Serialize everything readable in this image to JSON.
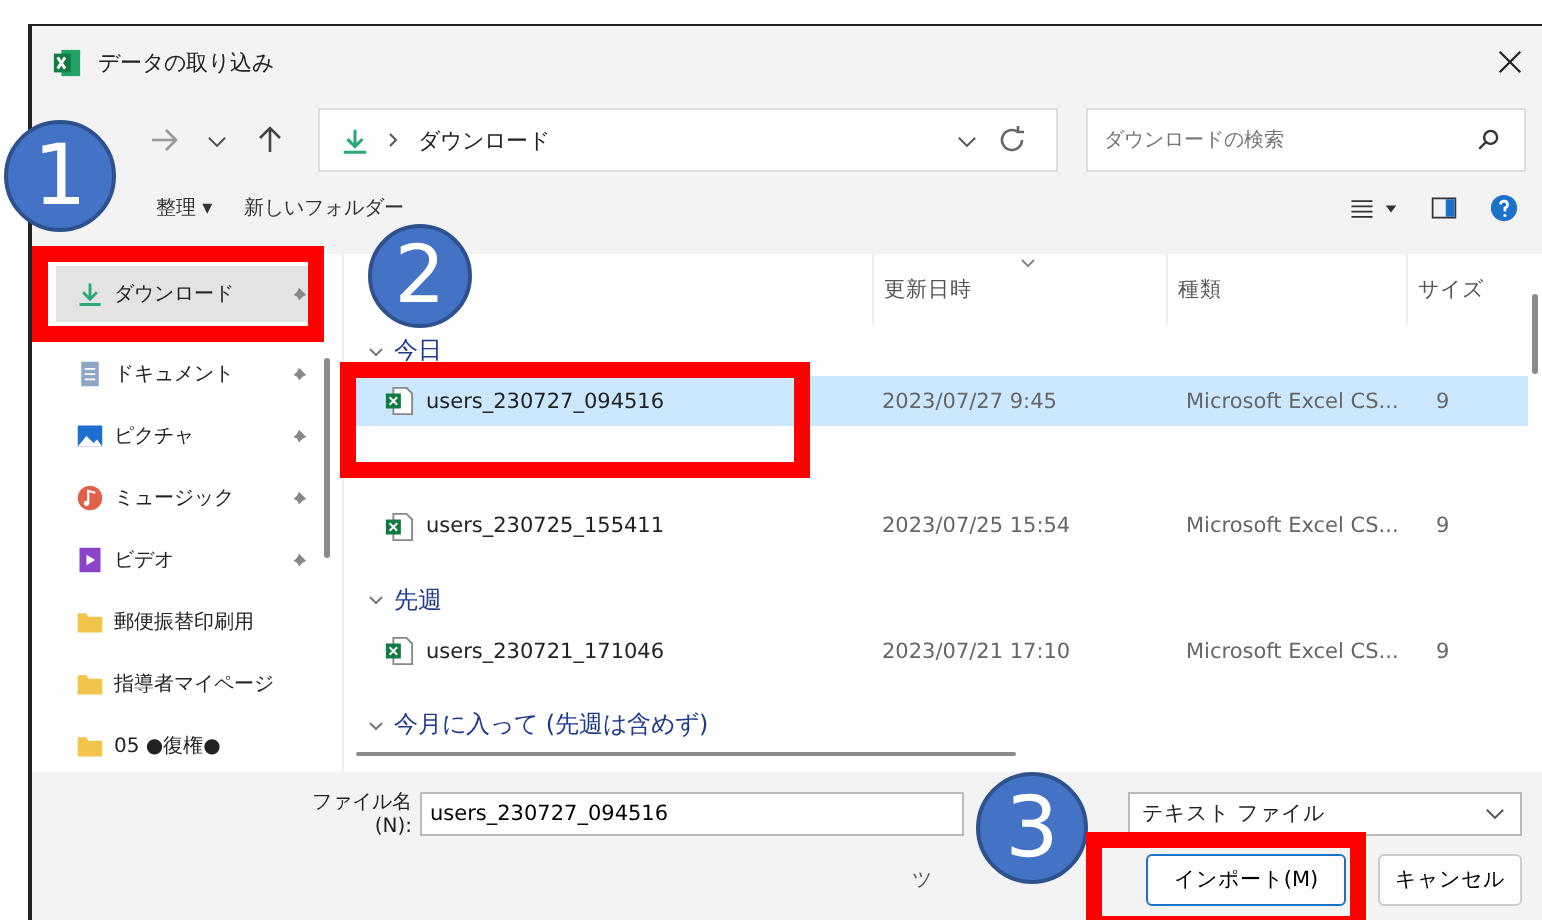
{
  "window": {
    "title": "データの取り込み"
  },
  "address": {
    "location": "ダウンロード"
  },
  "search": {
    "placeholder": "ダウンロードの検索"
  },
  "toolbar": {
    "items": [
      "整理 ▾",
      "新しいフォルダー"
    ]
  },
  "sidebar": {
    "items": [
      {
        "kind": "download",
        "label": "ダウンロード",
        "pinned": true,
        "selected": true
      },
      {
        "kind": "document",
        "label": "ドキュメント",
        "pinned": true,
        "selected": false
      },
      {
        "kind": "picture",
        "label": "ピクチャ",
        "pinned": true,
        "selected": false
      },
      {
        "kind": "music",
        "label": "ミュージック",
        "pinned": true,
        "selected": false
      },
      {
        "kind": "video",
        "label": "ビデオ",
        "pinned": true,
        "selected": false
      },
      {
        "kind": "folder",
        "label": "郵便振替印刷用",
        "pinned": false,
        "selected": false
      },
      {
        "kind": "folder",
        "label": "指導者マイページ",
        "pinned": false,
        "selected": false
      },
      {
        "kind": "folder",
        "label": "05 ●復権●",
        "pinned": false,
        "selected": false
      }
    ]
  },
  "table": {
    "columns": [
      {
        "label": "更新日時",
        "sorted": true
      },
      {
        "label": "種類",
        "sorted": false
      },
      {
        "label": "サイズ",
        "sorted": false
      }
    ],
    "groups": [
      {
        "label": "今日",
        "rows": [
          {
            "name": "users_230727_094516",
            "modified": "2023/07/27 9:45",
            "type": "Microsoft Excel CS...",
            "size": "9",
            "selected": true
          }
        ]
      },
      {
        "rows": [
          {
            "name": "users_230725_155411",
            "modified": "2023/07/25 15:54",
            "type": "Microsoft Excel CS...",
            "size": "9",
            "selected": false
          }
        ]
      },
      {
        "label": "先週",
        "rows": [
          {
            "name": "users_230721_171046",
            "modified": "2023/07/21 17:10",
            "type": "Microsoft Excel CS...",
            "size": "9",
            "selected": false
          }
        ]
      },
      {
        "label": "今月に入って (先週は含めず)"
      }
    ]
  },
  "footer": {
    "filename_label": "ファイル名(N):",
    "filename": "users_230727_094516",
    "filetype": "テキスト ファイル",
    "tools_label": "ツ",
    "buttons": [
      "インポート(M)",
      "キャンセル"
    ]
  },
  "annotations": [
    {
      "number": "1"
    },
    {
      "number": "2"
    },
    {
      "number": "3"
    }
  ]
}
